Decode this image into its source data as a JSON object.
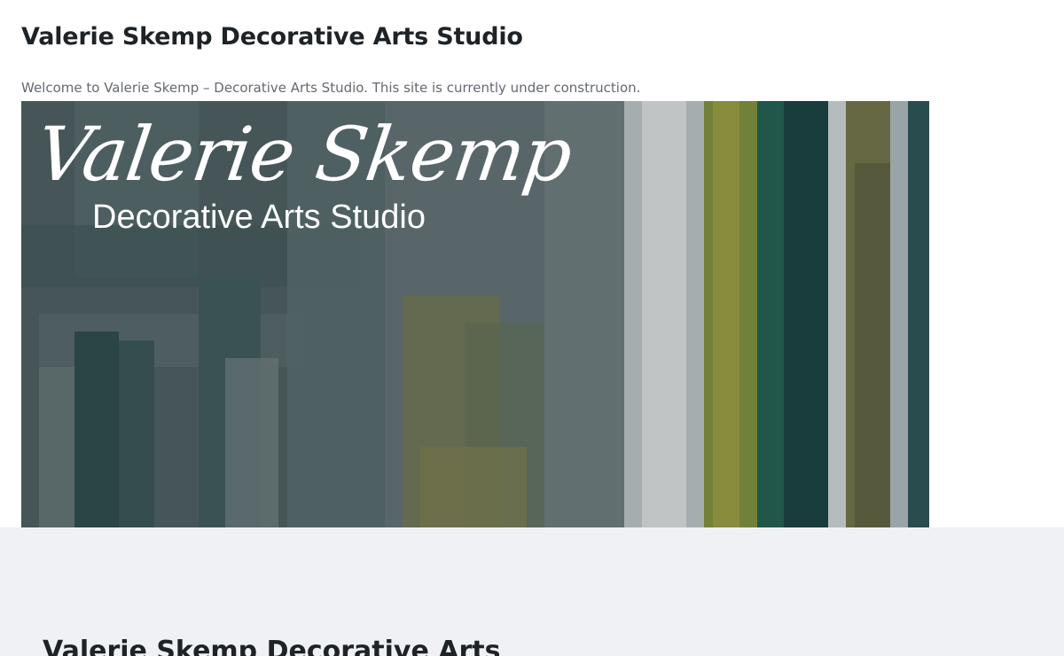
{
  "header": {
    "site_title": "Valerie Skemp Decorative Arts Studio",
    "welcome_text": "Welcome to Valerie Skemp – Decorative Arts Studio. This site is currently under construction."
  },
  "banner": {
    "logo_script": "Valerie Skemp",
    "logo_subtitle": "Decorative Arts Studio",
    "colors": {
      "base": "#4b5a5c",
      "teal": "#1f4a4c",
      "olive": "#8a8a3a",
      "pale": "#c9cfd0"
    }
  },
  "footer": {
    "title": "Valerie Skemp Decorative Arts"
  }
}
